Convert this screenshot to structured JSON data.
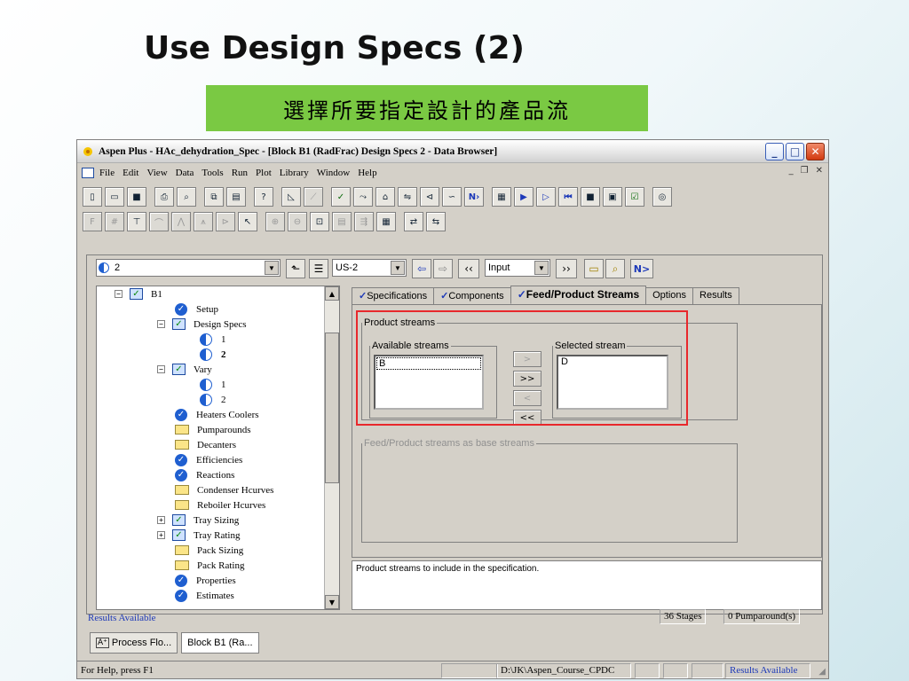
{
  "slide": {
    "title": "Use Design Specs (2)",
    "subtitle": "選擇所要指定設計的產品流"
  },
  "window": {
    "title": "Aspen Plus - HAc_dehydration_Spec - [Block B1 (RadFrac) Design Specs 2 - Data Browser]",
    "controls": [
      "minimize-icon",
      "maximize-icon",
      "close-icon"
    ]
  },
  "menu": {
    "items": [
      "File",
      "Edit",
      "View",
      "Data",
      "Tools",
      "Run",
      "Plot",
      "Library",
      "Window",
      "Help"
    ]
  },
  "browser": {
    "id_combo": "2",
    "block_combo": "US-2",
    "mode_combo": "Input",
    "next_label": "N>"
  },
  "tree": {
    "items": [
      {
        "label": "B1",
        "icon": "check-box-icon"
      },
      {
        "label": "Setup",
        "icon": "check-circle-icon"
      },
      {
        "label": "Design Specs",
        "icon": "check-box-icon"
      },
      {
        "label": "1",
        "icon": "half-circle-icon"
      },
      {
        "label": "2",
        "icon": "half-circle-icon"
      },
      {
        "label": "Vary",
        "icon": "check-box-icon"
      },
      {
        "label": "1",
        "icon": "half-circle-icon"
      },
      {
        "label": "2",
        "icon": "half-circle-icon"
      },
      {
        "label": "Heaters Coolers",
        "icon": "check-circle-icon"
      },
      {
        "label": "Pumparounds",
        "icon": "folder-icon"
      },
      {
        "label": "Decanters",
        "icon": "folder-icon"
      },
      {
        "label": "Efficiencies",
        "icon": "check-circle-icon"
      },
      {
        "label": "Reactions",
        "icon": "check-circle-icon"
      },
      {
        "label": "Condenser Hcurves",
        "icon": "folder-icon"
      },
      {
        "label": "Reboiler Hcurves",
        "icon": "folder-icon"
      },
      {
        "label": "Tray Sizing",
        "icon": "check-box-icon"
      },
      {
        "label": "Tray Rating",
        "icon": "check-box-icon"
      },
      {
        "label": "Pack Sizing",
        "icon": "folder-icon"
      },
      {
        "label": "Pack Rating",
        "icon": "folder-icon"
      },
      {
        "label": "Properties",
        "icon": "check-circle-icon"
      },
      {
        "label": "Estimates",
        "icon": "check-circle-icon"
      }
    ]
  },
  "tabs": {
    "specifications": "Specifications",
    "components": "Components",
    "feed_product": "Feed/Product Streams",
    "options": "Options",
    "results": "Results"
  },
  "form": {
    "product_streams_legend": "Product streams",
    "available_legend": "Available streams",
    "available_items": [
      "B"
    ],
    "selected_legend": "Selected stream",
    "selected_items": [
      "D"
    ],
    "move_right": ">",
    "move_all_right": ">>",
    "move_left": "<",
    "move_all_left": "<<",
    "feed_base_legend": "Feed/Product streams as base streams"
  },
  "prompt_text": "Product streams to include in the specification.",
  "status_row": {
    "left": "Results Available",
    "stages": "36 Stages",
    "pumparounds": "0 Pumparound(s)"
  },
  "mdi_tabs": {
    "process_flowsheet": "Process Flo...",
    "block": "Block B1 (Ra..."
  },
  "statusbar": {
    "help": "For Help, press F1",
    "path": "D:\\JK\\Aspen_Course_CPDC",
    "results": "Results Available"
  },
  "colors": {
    "subtitle_bg": "#7ac943",
    "highlight": "#e8282c",
    "accent_blue": "#1f5fd0"
  }
}
